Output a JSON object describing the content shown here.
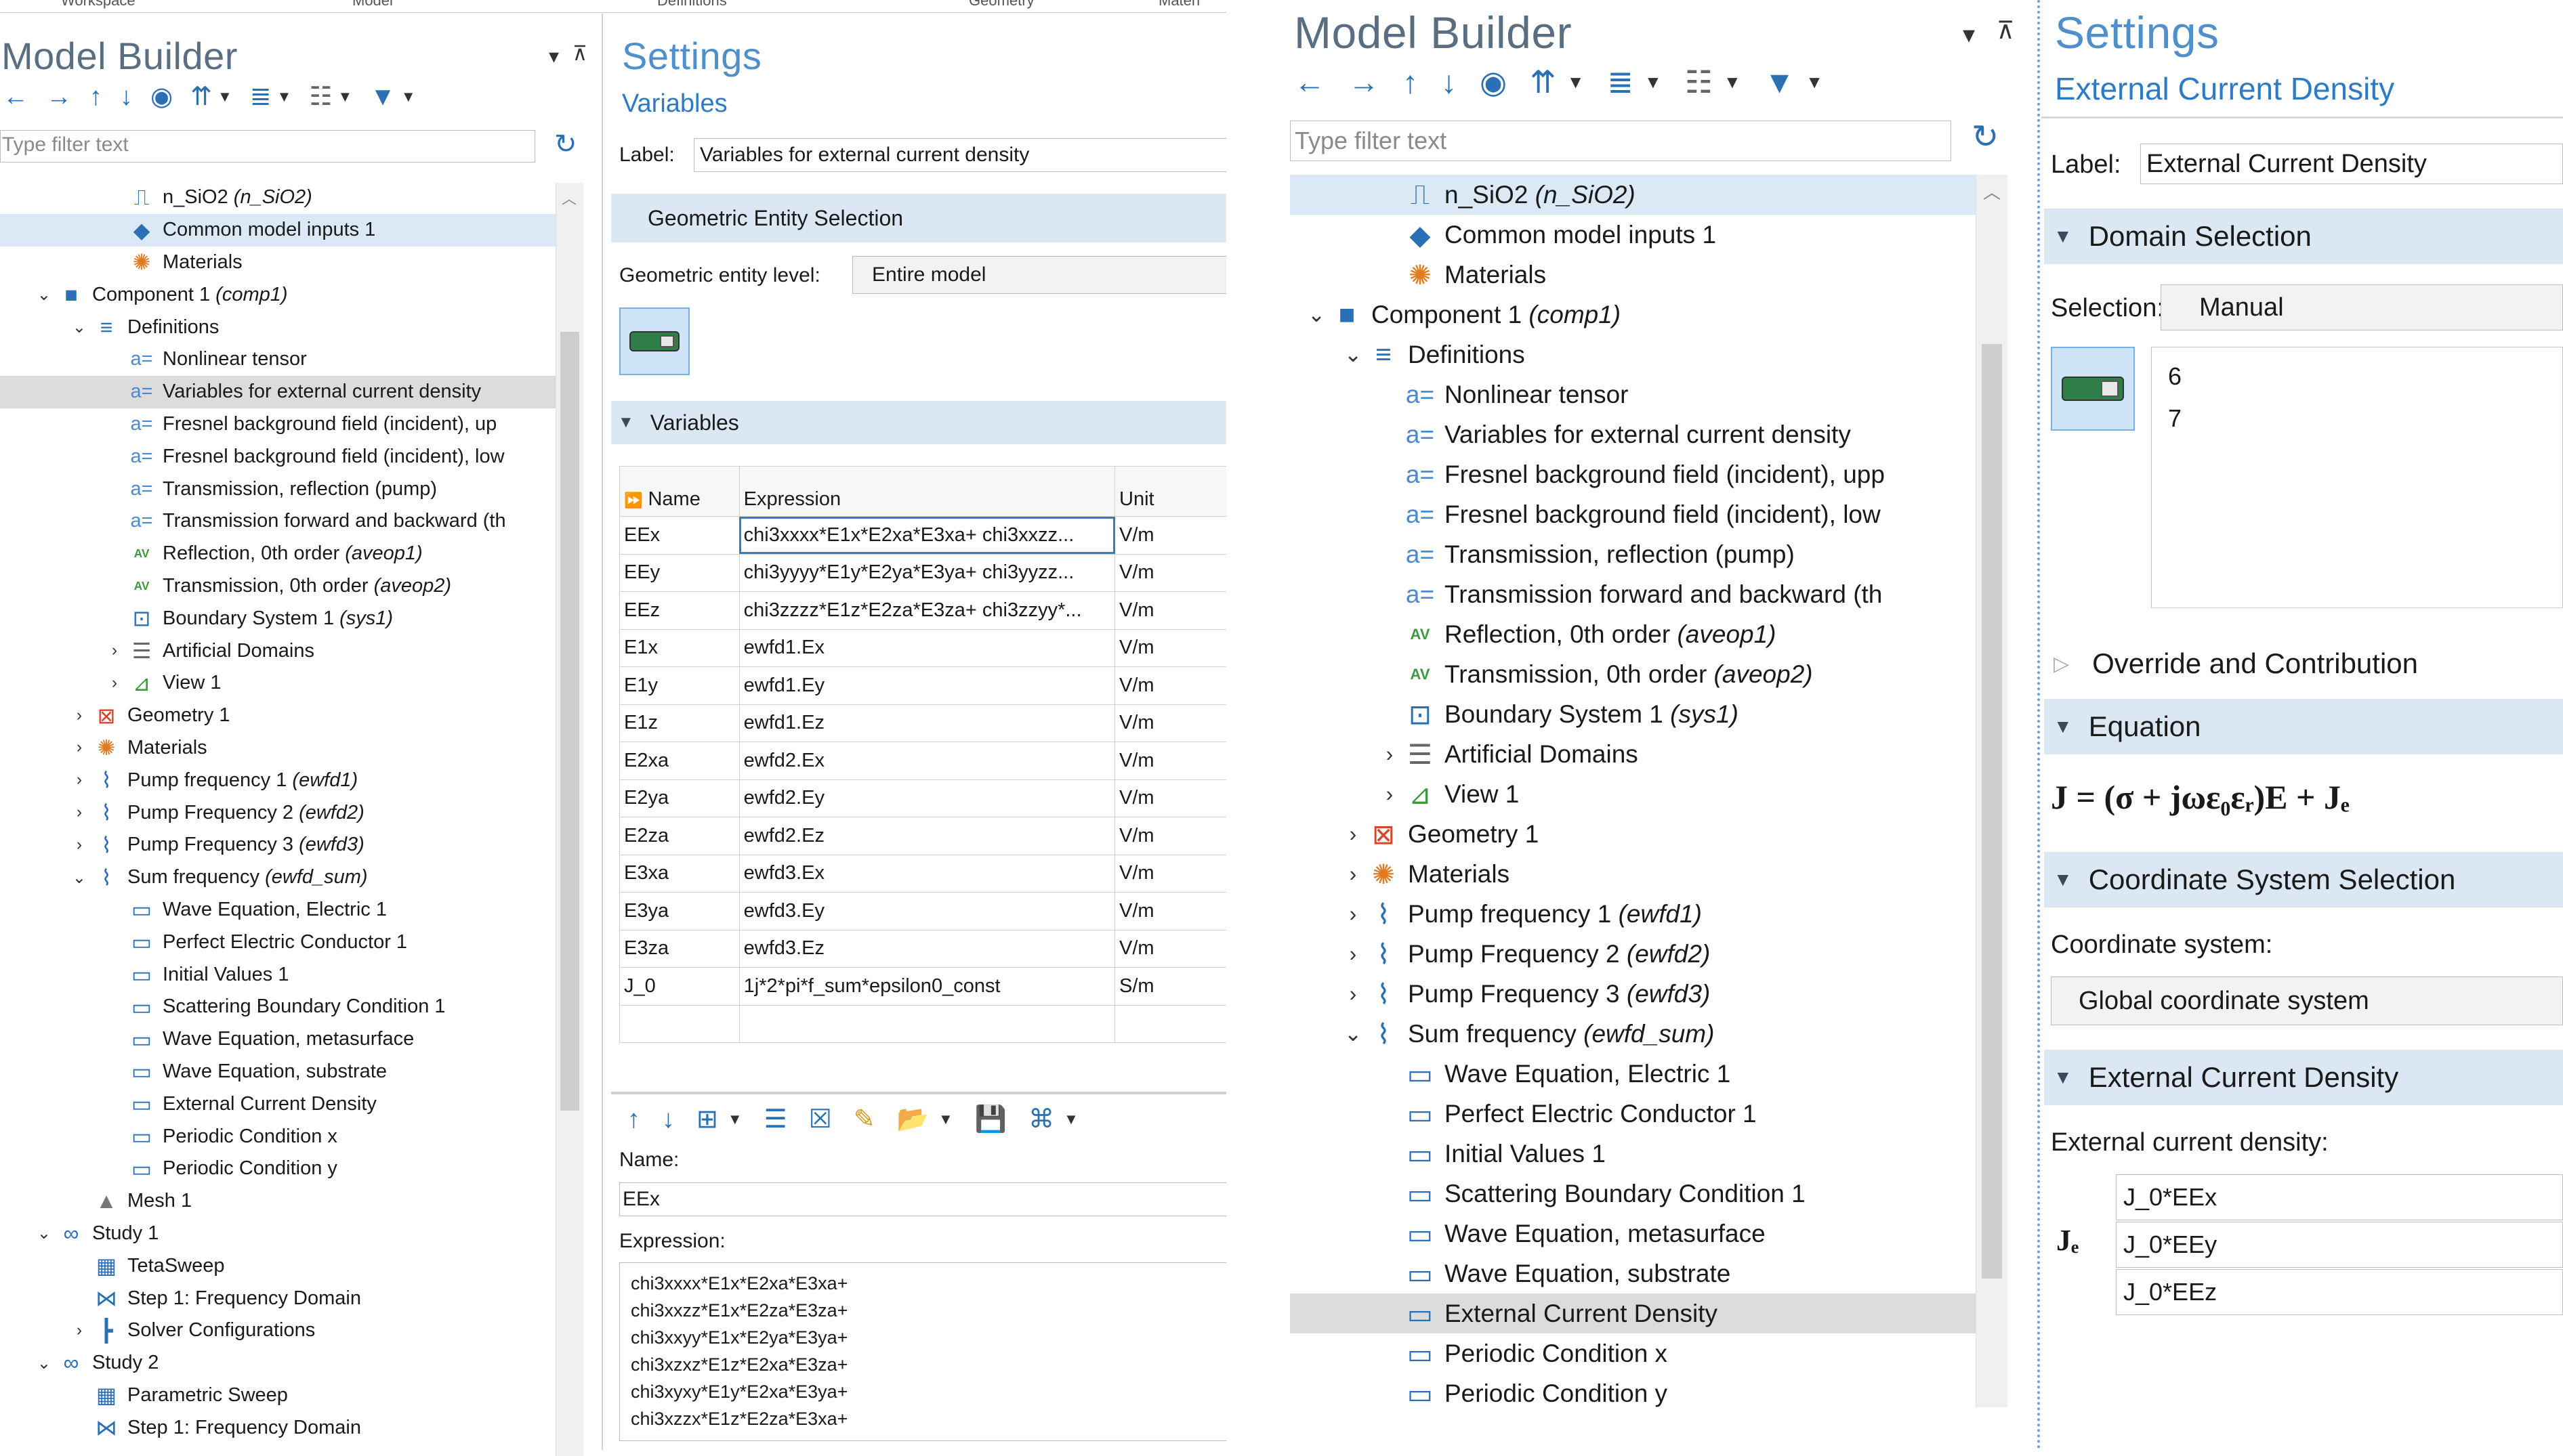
{
  "ribbon": [
    "Workspace",
    "Model",
    "Definitions",
    "Geometry",
    "Materi"
  ],
  "left_mb": {
    "title": "Model Builder",
    "filter_placeholder": "Type filter text",
    "tree": [
      {
        "label": "n_SiO2",
        "tag": "(n_SiO2)",
        "icon": "function-icon",
        "glyph": "⎍",
        "color": "#2b6fb5",
        "indent": 3,
        "chev": ""
      },
      {
        "label": "Common model inputs 1",
        "tag": "",
        "icon": "common-inputs-icon",
        "glyph": "◆",
        "color": "#2b6fb5",
        "indent": 3,
        "chev": "",
        "state": "hl"
      },
      {
        "label": "Materials",
        "tag": "",
        "icon": "materials-icon",
        "glyph": "✺",
        "color": "#e07b1f",
        "indent": 3,
        "chev": ""
      },
      {
        "label": "Component 1",
        "tag": "(comp1)",
        "icon": "component-icon",
        "glyph": "■",
        "color": "#2b6fb5",
        "indent": 1,
        "chev": "⌄"
      },
      {
        "label": "Definitions",
        "tag": "",
        "icon": "definitions-icon",
        "glyph": "≡",
        "color": "#2b6fb5",
        "indent": 2,
        "chev": "⌄"
      },
      {
        "label": "Nonlinear tensor",
        "tag": "",
        "icon": "variables-icon",
        "glyph": "a=",
        "color": "#4b8ad0",
        "indent": 3,
        "chev": ""
      },
      {
        "label": "Variables for external current density",
        "tag": "",
        "icon": "variables-icon",
        "glyph": "a=",
        "color": "#4b8ad0",
        "indent": 3,
        "chev": "",
        "state": "sel"
      },
      {
        "label": "Fresnel background field (incident), up",
        "tag": "",
        "icon": "variables-icon",
        "glyph": "a=",
        "color": "#4b8ad0",
        "indent": 3,
        "chev": ""
      },
      {
        "label": "Fresnel background field (incident), low",
        "tag": "",
        "icon": "variables-icon",
        "glyph": "a=",
        "color": "#4b8ad0",
        "indent": 3,
        "chev": ""
      },
      {
        "label": "Transmission, reflection (pump)",
        "tag": "",
        "icon": "variables-icon",
        "glyph": "a=",
        "color": "#4b8ad0",
        "indent": 3,
        "chev": ""
      },
      {
        "label": "Transmission forward and backward (th",
        "tag": "",
        "icon": "variables-icon",
        "glyph": "a=",
        "color": "#4b8ad0",
        "indent": 3,
        "chev": ""
      },
      {
        "label": "Reflection, 0th order",
        "tag": "(aveop1)",
        "icon": "average-operator-icon",
        "glyph": "AV",
        "color": "#3f9a3f",
        "indent": 3,
        "chev": ""
      },
      {
        "label": "Transmission, 0th order",
        "tag": "(aveop2)",
        "icon": "average-operator-icon",
        "glyph": "AV",
        "color": "#3f9a3f",
        "indent": 3,
        "chev": ""
      },
      {
        "label": "Boundary System 1",
        "tag": "(sys1)",
        "icon": "coordinate-system-icon",
        "glyph": "⊡",
        "color": "#2b6fb5",
        "indent": 3,
        "chev": ""
      },
      {
        "label": "Artificial Domains",
        "tag": "",
        "icon": "artificial-domains-icon",
        "glyph": "☰",
        "color": "#666666",
        "indent": 3,
        "chev": "›"
      },
      {
        "label": "View 1",
        "tag": "",
        "icon": "view-icon",
        "glyph": "⊿",
        "color": "#3f9a3f",
        "indent": 3,
        "chev": "›"
      },
      {
        "label": "Geometry 1",
        "tag": "",
        "icon": "geometry-icon",
        "glyph": "⊠",
        "color": "#d9452b",
        "indent": 2,
        "chev": "›"
      },
      {
        "label": "Materials",
        "tag": "",
        "icon": "materials-icon",
        "glyph": "✺",
        "color": "#e07b1f",
        "indent": 2,
        "chev": "›"
      },
      {
        "label": "Pump frequency 1",
        "tag": "(ewfd1)",
        "icon": "wave-physics-icon",
        "glyph": "⌇",
        "color": "#2b6fb5",
        "indent": 2,
        "chev": "›"
      },
      {
        "label": "Pump Frequency 2",
        "tag": "(ewfd2)",
        "icon": "wave-physics-icon",
        "glyph": "⌇",
        "color": "#2b6fb5",
        "indent": 2,
        "chev": "›"
      },
      {
        "label": "Pump Frequency 3",
        "tag": "(ewfd3)",
        "icon": "wave-physics-icon",
        "glyph": "⌇",
        "color": "#2b6fb5",
        "indent": 2,
        "chev": "›"
      },
      {
        "label": "Sum frequency",
        "tag": "(ewfd_sum)",
        "icon": "wave-physics-icon",
        "glyph": "⌇",
        "color": "#2b6fb5",
        "indent": 2,
        "chev": "⌄"
      },
      {
        "label": "Wave Equation, Electric 1",
        "tag": "",
        "icon": "physics-feature-icon",
        "glyph": "▭",
        "color": "#2b6fb5",
        "indent": 3,
        "chev": ""
      },
      {
        "label": "Perfect Electric Conductor 1",
        "tag": "",
        "icon": "physics-feature-icon",
        "glyph": "▭",
        "color": "#2b6fb5",
        "indent": 3,
        "chev": ""
      },
      {
        "label": "Initial Values 1",
        "tag": "",
        "icon": "physics-feature-icon",
        "glyph": "▭",
        "color": "#2b6fb5",
        "indent": 3,
        "chev": ""
      },
      {
        "label": "Scattering Boundary Condition 1",
        "tag": "",
        "icon": "physics-feature-icon",
        "glyph": "▭",
        "color": "#2b6fb5",
        "indent": 3,
        "chev": ""
      },
      {
        "label": "Wave Equation, metasurface",
        "tag": "",
        "icon": "physics-feature-icon",
        "glyph": "▭",
        "color": "#2b6fb5",
        "indent": 3,
        "chev": ""
      },
      {
        "label": "Wave Equation, substrate",
        "tag": "",
        "icon": "physics-feature-icon",
        "glyph": "▭",
        "color": "#2b6fb5",
        "indent": 3,
        "chev": ""
      },
      {
        "label": "External Current Density",
        "tag": "",
        "icon": "physics-feature-icon",
        "glyph": "▭",
        "color": "#2b6fb5",
        "indent": 3,
        "chev": ""
      },
      {
        "label": "Periodic Condition x",
        "tag": "",
        "icon": "physics-feature-icon",
        "glyph": "▭",
        "color": "#2b6fb5",
        "indent": 3,
        "chev": ""
      },
      {
        "label": "Periodic Condition y",
        "tag": "",
        "icon": "physics-feature-icon",
        "glyph": "▭",
        "color": "#2b6fb5",
        "indent": 3,
        "chev": ""
      },
      {
        "label": "Mesh 1",
        "tag": "",
        "icon": "mesh-icon",
        "glyph": "▲",
        "color": "#777777",
        "indent": 2,
        "chev": ""
      },
      {
        "label": "Study 1",
        "tag": "",
        "icon": "study-icon",
        "glyph": "∞",
        "color": "#2b6fb5",
        "indent": 1,
        "chev": "⌄"
      },
      {
        "label": "TetaSweep",
        "tag": "",
        "icon": "parametric-sweep-icon",
        "glyph": "▦",
        "color": "#2b6fb5",
        "indent": 2,
        "chev": ""
      },
      {
        "label": "Step 1: Frequency Domain",
        "tag": "",
        "icon": "frequency-domain-icon",
        "glyph": "⋈",
        "color": "#2b6fb5",
        "indent": 2,
        "chev": ""
      },
      {
        "label": "Solver Configurations",
        "tag": "",
        "icon": "solver-icon",
        "glyph": "┣",
        "color": "#2b6fb5",
        "indent": 2,
        "chev": "›"
      },
      {
        "label": "Study 2",
        "tag": "",
        "icon": "study-icon",
        "glyph": "∞",
        "color": "#2b6fb5",
        "indent": 1,
        "chev": "⌄"
      },
      {
        "label": "Parametric Sweep",
        "tag": "",
        "icon": "parametric-sweep-icon",
        "glyph": "▦",
        "color": "#2b6fb5",
        "indent": 2,
        "chev": ""
      },
      {
        "label": "Step 1: Frequency Domain",
        "tag": "",
        "icon": "frequency-domain-icon",
        "glyph": "⋈",
        "color": "#2b6fb5",
        "indent": 2,
        "chev": ""
      }
    ]
  },
  "left_settings": {
    "title": "Settings",
    "subtitle": "Variables",
    "label_caption": "Label:",
    "label_value": "Variables for external current density",
    "geo_section": "Geometric Entity Selection",
    "geo_level_caption": "Geometric entity level:",
    "geo_level_value": "Entire model",
    "variables_section": "Variables",
    "table_headers": [
      "Name",
      "Expression",
      "Unit"
    ],
    "rows": [
      [
        "EEx",
        "chi3xxxx*E1x*E2xa*E3xa+ chi3xxzz...",
        "V/m"
      ],
      [
        "EEy",
        "chi3yyyy*E1y*E2ya*E3ya+ chi3yyzz...",
        "V/m"
      ],
      [
        "EEz",
        "chi3zzzz*E1z*E2za*E3za+ chi3zzyy*...",
        "V/m"
      ],
      [
        "E1x",
        "ewfd1.Ex",
        "V/m"
      ],
      [
        "E1y",
        "ewfd1.Ey",
        "V/m"
      ],
      [
        "E1z",
        "ewfd1.Ez",
        "V/m"
      ],
      [
        "E2xa",
        "ewfd2.Ex",
        "V/m"
      ],
      [
        "E2ya",
        "ewfd2.Ey",
        "V/m"
      ],
      [
        "E2za",
        "ewfd2.Ez",
        "V/m"
      ],
      [
        "E3xa",
        "ewfd3.Ex",
        "V/m"
      ],
      [
        "E3ya",
        "ewfd3.Ey",
        "V/m"
      ],
      [
        "E3za",
        "ewfd3.Ez",
        "V/m"
      ],
      [
        "J_0",
        "1j*2*pi*f_sum*epsilon0_const",
        "S/m"
      ],
      [
        "",
        "",
        ""
      ]
    ],
    "name_caption": "Name:",
    "name_value": "EEx",
    "expression_caption": "Expression:",
    "expression_lines": [
      "chi3xxxx*E1x*E2xa*E3xa+",
      "chi3xxzz*E1x*E2za*E3za+",
      "chi3xxyy*E1x*E2ya*E3ya+",
      "chi3xzxz*E1z*E2xa*E3za+",
      "chi3xyxy*E1y*E2xa*E3ya+",
      "chi3xzzx*E1z*E2za*E3xa+"
    ]
  },
  "right_mb": {
    "title": "Model Builder",
    "filter_placeholder": "Type filter text",
    "tree": [
      {
        "label": "n_SiO2",
        "tag": "(n_SiO2)",
        "icon": "function-icon",
        "glyph": "⎍",
        "color": "#2b6fb5",
        "indent": 3,
        "chev": "",
        "state": "hl"
      },
      {
        "label": "Common model inputs 1",
        "tag": "",
        "icon": "common-inputs-icon",
        "glyph": "◆",
        "color": "#2b6fb5",
        "indent": 3,
        "chev": ""
      },
      {
        "label": "Materials",
        "tag": "",
        "icon": "materials-icon",
        "glyph": "✺",
        "color": "#e07b1f",
        "indent": 3,
        "chev": ""
      },
      {
        "label": "Component 1",
        "tag": "(comp1)",
        "icon": "component-icon",
        "glyph": "■",
        "color": "#2b6fb5",
        "indent": 1,
        "chev": "⌄"
      },
      {
        "label": "Definitions",
        "tag": "",
        "icon": "definitions-icon",
        "glyph": "≡",
        "color": "#2b6fb5",
        "indent": 2,
        "chev": "⌄"
      },
      {
        "label": "Nonlinear tensor",
        "tag": "",
        "icon": "variables-icon",
        "glyph": "a=",
        "color": "#4b8ad0",
        "indent": 3,
        "chev": ""
      },
      {
        "label": "Variables for external current density",
        "tag": "",
        "icon": "variables-icon",
        "glyph": "a=",
        "color": "#4b8ad0",
        "indent": 3,
        "chev": ""
      },
      {
        "label": "Fresnel background field (incident), upp",
        "tag": "",
        "icon": "variables-icon",
        "glyph": "a=",
        "color": "#4b8ad0",
        "indent": 3,
        "chev": ""
      },
      {
        "label": "Fresnel background field (incident), low",
        "tag": "",
        "icon": "variables-icon",
        "glyph": "a=",
        "color": "#4b8ad0",
        "indent": 3,
        "chev": ""
      },
      {
        "label": "Transmission, reflection (pump)",
        "tag": "",
        "icon": "variables-icon",
        "glyph": "a=",
        "color": "#4b8ad0",
        "indent": 3,
        "chev": ""
      },
      {
        "label": "Transmission forward and backward (th",
        "tag": "",
        "icon": "variables-icon",
        "glyph": "a=",
        "color": "#4b8ad0",
        "indent": 3,
        "chev": ""
      },
      {
        "label": "Reflection, 0th order",
        "tag": "(aveop1)",
        "icon": "average-operator-icon",
        "glyph": "AV",
        "color": "#3f9a3f",
        "indent": 3,
        "chev": ""
      },
      {
        "label": "Transmission, 0th order",
        "tag": "(aveop2)",
        "icon": "average-operator-icon",
        "glyph": "AV",
        "color": "#3f9a3f",
        "indent": 3,
        "chev": ""
      },
      {
        "label": "Boundary System 1",
        "tag": "(sys1)",
        "icon": "coordinate-system-icon",
        "glyph": "⊡",
        "color": "#2b6fb5",
        "indent": 3,
        "chev": ""
      },
      {
        "label": "Artificial Domains",
        "tag": "",
        "icon": "artificial-domains-icon",
        "glyph": "☰",
        "color": "#666666",
        "indent": 3,
        "chev": "›"
      },
      {
        "label": "View 1",
        "tag": "",
        "icon": "view-icon",
        "glyph": "⊿",
        "color": "#3f9a3f",
        "indent": 3,
        "chev": "›"
      },
      {
        "label": "Geometry 1",
        "tag": "",
        "icon": "geometry-icon",
        "glyph": "⊠",
        "color": "#d9452b",
        "indent": 2,
        "chev": "›"
      },
      {
        "label": "Materials",
        "tag": "",
        "icon": "materials-icon",
        "glyph": "✺",
        "color": "#e07b1f",
        "indent": 2,
        "chev": "›"
      },
      {
        "label": "Pump frequency 1",
        "tag": "(ewfd1)",
        "icon": "wave-physics-icon",
        "glyph": "⌇",
        "color": "#2b6fb5",
        "indent": 2,
        "chev": "›"
      },
      {
        "label": "Pump Frequency 2",
        "tag": "(ewfd2)",
        "icon": "wave-physics-icon",
        "glyph": "⌇",
        "color": "#2b6fb5",
        "indent": 2,
        "chev": "›"
      },
      {
        "label": "Pump Frequency 3",
        "tag": "(ewfd3)",
        "icon": "wave-physics-icon",
        "glyph": "⌇",
        "color": "#2b6fb5",
        "indent": 2,
        "chev": "›"
      },
      {
        "label": "Sum frequency",
        "tag": "(ewfd_sum)",
        "icon": "wave-physics-icon",
        "glyph": "⌇",
        "color": "#2b6fb5",
        "indent": 2,
        "chev": "⌄"
      },
      {
        "label": "Wave Equation, Electric 1",
        "tag": "",
        "icon": "physics-feature-icon",
        "glyph": "▭",
        "color": "#2b6fb5",
        "indent": 3,
        "chev": ""
      },
      {
        "label": "Perfect Electric Conductor 1",
        "tag": "",
        "icon": "physics-feature-icon",
        "glyph": "▭",
        "color": "#2b6fb5",
        "indent": 3,
        "chev": ""
      },
      {
        "label": "Initial Values 1",
        "tag": "",
        "icon": "physics-feature-icon",
        "glyph": "▭",
        "color": "#2b6fb5",
        "indent": 3,
        "chev": ""
      },
      {
        "label": "Scattering Boundary Condition 1",
        "tag": "",
        "icon": "physics-feature-icon",
        "glyph": "▭",
        "color": "#2b6fb5",
        "indent": 3,
        "chev": ""
      },
      {
        "label": "Wave Equation, metasurface",
        "tag": "",
        "icon": "physics-feature-icon",
        "glyph": "▭",
        "color": "#2b6fb5",
        "indent": 3,
        "chev": ""
      },
      {
        "label": "Wave Equation, substrate",
        "tag": "",
        "icon": "physics-feature-icon",
        "glyph": "▭",
        "color": "#2b6fb5",
        "indent": 3,
        "chev": ""
      },
      {
        "label": "External Current Density",
        "tag": "",
        "icon": "physics-feature-icon",
        "glyph": "▭",
        "color": "#2b6fb5",
        "indent": 3,
        "chev": "",
        "state": "sel"
      },
      {
        "label": "Periodic Condition x",
        "tag": "",
        "icon": "physics-feature-icon",
        "glyph": "▭",
        "color": "#2b6fb5",
        "indent": 3,
        "chev": ""
      },
      {
        "label": "Periodic Condition y",
        "tag": "",
        "icon": "physics-feature-icon",
        "glyph": "▭",
        "color": "#2b6fb5",
        "indent": 3,
        "chev": ""
      }
    ]
  },
  "right_settings": {
    "title": "Settings",
    "subtitle": "External Current Density",
    "label_caption": "Label:",
    "label_value": "External Current Density",
    "domain_section": "Domain Selection",
    "selection_caption": "Selection:",
    "selection_value": "Manual",
    "selection_items": [
      "6",
      "7"
    ],
    "override_section": "Override and Contribution",
    "equation_section": "Equation",
    "equation_text": "J = (σ + jωε₀εᵣ)E + Jₑ",
    "coord_section": "Coordinate System Selection",
    "coord_caption": "Coordinate system:",
    "coord_value": "Global coordinate system",
    "ecd_section": "External Current Density",
    "ecd_caption": "External current density:",
    "je_symbol": "Jₑ",
    "je_values": [
      "J_0*EEx",
      "J_0*EEy",
      "J_0*EEz"
    ]
  }
}
